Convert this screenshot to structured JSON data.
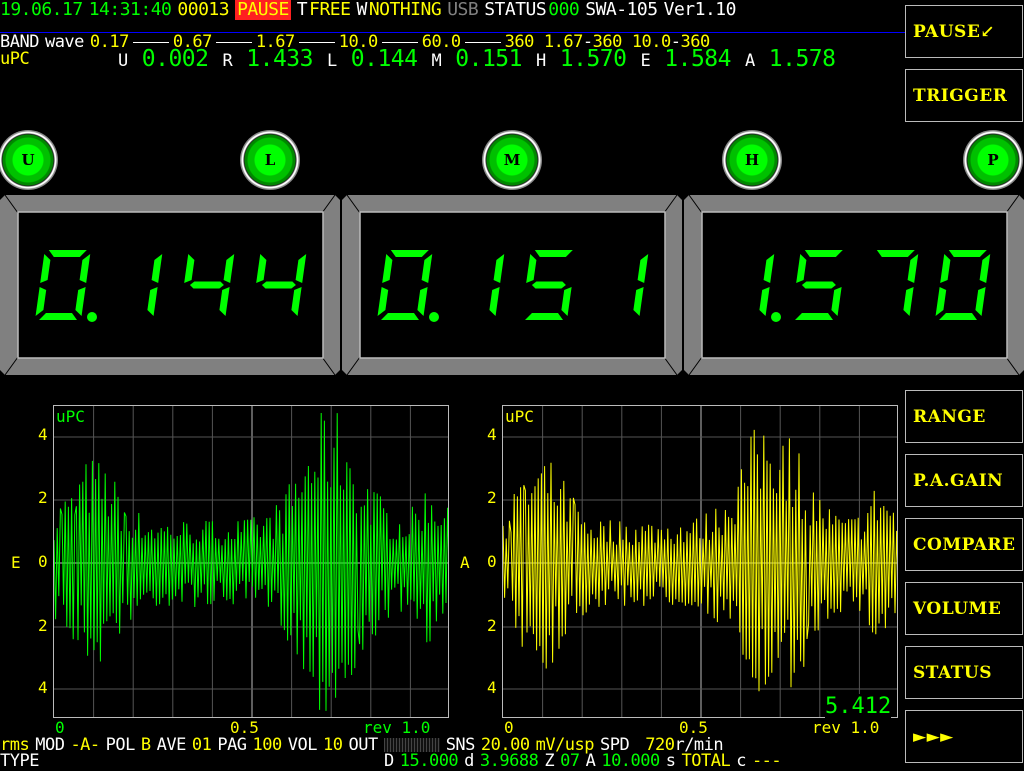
{
  "status_bar": {
    "date": "19.06.17",
    "time": "14:31:40",
    "counter": "00013",
    "pause": "PAUSE",
    "t_label": "T",
    "t_value": "FREE",
    "w_label": "W",
    "w_value": "NOTHING",
    "usb": "USB",
    "status_label": "STATUS",
    "status_value": "000",
    "model": "SWA-105",
    "version": "Ver1.10"
  },
  "band_row": {
    "label": "BAND",
    "mode": "wave",
    "bands": [
      "0.17",
      "0.67",
      "1.67",
      "10.0",
      "60.0",
      "360"
    ],
    "ranges": [
      "1.67",
      "360",
      "10.0",
      "360"
    ]
  },
  "upc_row": {
    "unit": "uPC",
    "items": [
      {
        "k": "U",
        "v": "0.002"
      },
      {
        "k": "R",
        "v": "1.433"
      },
      {
        "k": "L",
        "v": "0.144"
      },
      {
        "k": "M",
        "v": "0.151"
      },
      {
        "k": "H",
        "v": "1.570"
      },
      {
        "k": "E",
        "v": "1.584"
      },
      {
        "k": "A",
        "v": "1.578"
      }
    ]
  },
  "lamps": [
    "U",
    "L",
    "M",
    "H",
    "P"
  ],
  "meters": [
    "0.144",
    "0.151",
    "1.570"
  ],
  "buttons": {
    "pause": "PAUSE↙",
    "trigger": "TRIGGER",
    "range": "RANGE",
    "pa_gain": "P.A.GAIN",
    "compare": "COMPARE",
    "volume": "VOLUME",
    "status": "STATUS",
    "next": "►►►"
  },
  "plots": [
    {
      "unit": "uPC",
      "channel": "E",
      "y_ticks": [
        "4",
        "2",
        "0",
        "2",
        "4"
      ],
      "x_ticks": [
        "0",
        "0.5",
        "rev 1.0"
      ],
      "color": "#00ff00",
      "readout": ""
    },
    {
      "unit": "uPC",
      "channel": "A",
      "y_ticks": [
        "4",
        "2",
        "0",
        "2",
        "4"
      ],
      "x_ticks": [
        "0",
        "0.5",
        "rev 1.0"
      ],
      "color": "#ffff00",
      "readout": "5.412"
    }
  ],
  "bottom1": {
    "rms": "rms",
    "mod_l": "MOD",
    "mod_v": "-A-",
    "pol_l": "POL",
    "pol_v": "B",
    "ave_l": "AVE",
    "ave_v": "01",
    "pag_l": "PAG",
    "pag_v": "100",
    "vol_l": "VOL",
    "vol_v": "10",
    "out_l": "OUT",
    "sns_l": "SNS",
    "sns_v": "20.00",
    "sns_u": "mV/usp",
    "spd_l": "SPD",
    "spd_v": "720",
    "spd_u": "r/min"
  },
  "bottom2": {
    "type": "TYPE",
    "d_l": "D",
    "d_v": "15.000",
    "d2_l": "d",
    "d2_v": "3.9688",
    "z_l": "Z",
    "z_v": "07",
    "a_l": "A",
    "a_v": "10.000",
    "s_l": "s",
    "total": "TOTAL",
    "c_l": "c",
    "c_v": "---"
  }
}
